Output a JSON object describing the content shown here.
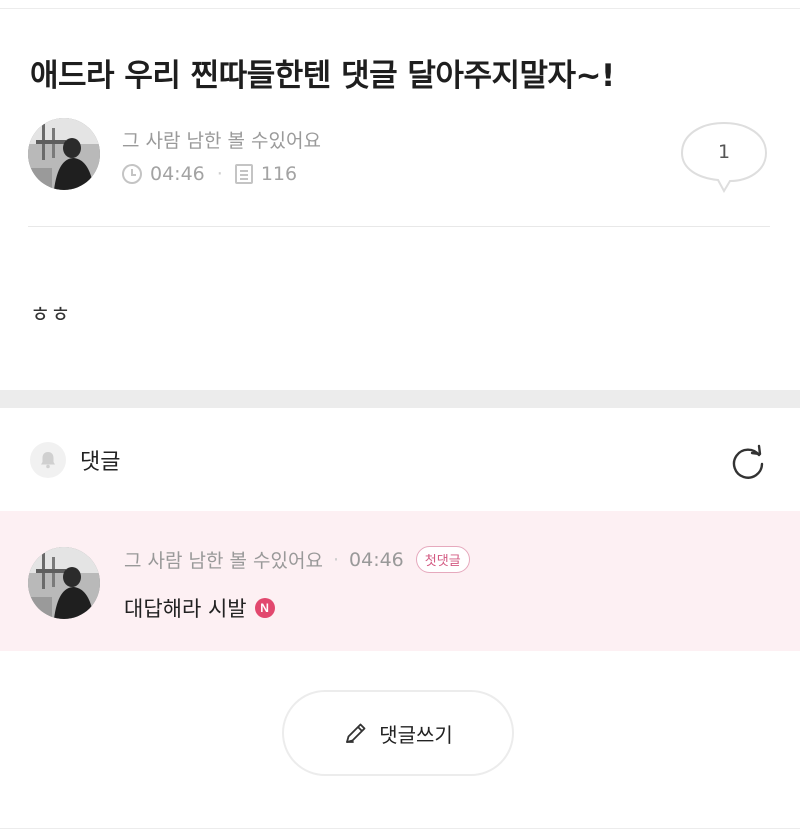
{
  "post": {
    "title": "애드라 우리 찐따들한텐 댓글 달아주지말자~!",
    "author": "그 사람 남한 볼 수있어요",
    "time": "04:46",
    "views": "116",
    "comment_count": "1",
    "body": "ㅎㅎ"
  },
  "comments_section": {
    "title": "댓글",
    "icons": {
      "bell": "bell-icon",
      "refresh": "refresh-icon"
    }
  },
  "comments": [
    {
      "author": "그 사람 남한 볼 수있어요",
      "time": "04:46",
      "badge": "첫댓글",
      "text": "대답해라 시발",
      "new_badge": "N"
    }
  ],
  "write_button": {
    "label": "댓글쓰기",
    "icon": "pencil-icon"
  },
  "colors": {
    "comment_highlight": "#fdf0f3",
    "badge_pink": "#d35a82",
    "new_badge": "#e2486e"
  }
}
